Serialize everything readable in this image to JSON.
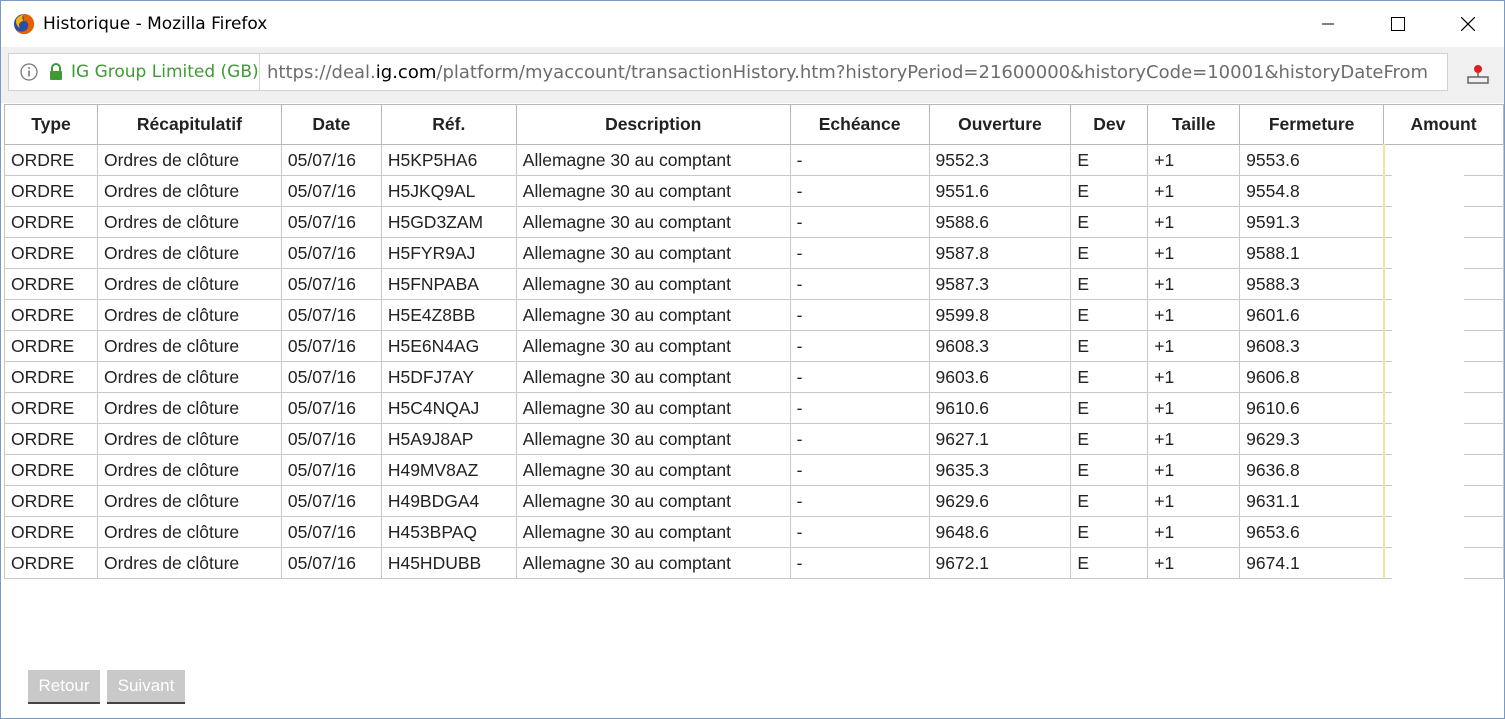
{
  "window": {
    "title": "Historique - Mozilla Firefox"
  },
  "address_bar": {
    "site_identity": "IG Group Limited (GB)",
    "url_prefix": "https://deal.",
    "url_domain": "ig.com",
    "url_path": "/platform/myaccount/transactionHistory.htm?historyPeriod=21600000&historyCode=10001&historyDateFrom"
  },
  "table": {
    "headers": [
      "Type",
      "Récapitulatif",
      "Date",
      "Réf.",
      "Description",
      "Echéance",
      "Ouverture",
      "Dev",
      "Taille",
      "Fermeture",
      "Amount"
    ],
    "rows": [
      [
        "ORDRE",
        "Ordres de clôture",
        "05/07/16",
        "H5KP5HA6",
        "Allemagne 30 au comptant",
        "-",
        "9552.3",
        "E",
        "+1",
        "9553.6",
        ""
      ],
      [
        "ORDRE",
        "Ordres de clôture",
        "05/07/16",
        "H5JKQ9AL",
        "Allemagne 30 au comptant",
        "-",
        "9551.6",
        "E",
        "+1",
        "9554.8",
        ""
      ],
      [
        "ORDRE",
        "Ordres de clôture",
        "05/07/16",
        "H5GD3ZAM",
        "Allemagne 30 au comptant",
        "-",
        "9588.6",
        "E",
        "+1",
        "9591.3",
        ""
      ],
      [
        "ORDRE",
        "Ordres de clôture",
        "05/07/16",
        "H5FYR9AJ",
        "Allemagne 30 au comptant",
        "-",
        "9587.8",
        "E",
        "+1",
        "9588.1",
        ""
      ],
      [
        "ORDRE",
        "Ordres de clôture",
        "05/07/16",
        "H5FNPABA",
        "Allemagne 30 au comptant",
        "-",
        "9587.3",
        "E",
        "+1",
        "9588.3",
        ""
      ],
      [
        "ORDRE",
        "Ordres de clôture",
        "05/07/16",
        "H5E4Z8BB",
        "Allemagne 30 au comptant",
        "-",
        "9599.8",
        "E",
        "+1",
        "9601.6",
        ""
      ],
      [
        "ORDRE",
        "Ordres de clôture",
        "05/07/16",
        "H5E6N4AG",
        "Allemagne 30 au comptant",
        "-",
        "9608.3",
        "E",
        "+1",
        "9608.3",
        ""
      ],
      [
        "ORDRE",
        "Ordres de clôture",
        "05/07/16",
        "H5DFJ7AY",
        "Allemagne 30 au comptant",
        "-",
        "9603.6",
        "E",
        "+1",
        "9606.8",
        ""
      ],
      [
        "ORDRE",
        "Ordres de clôture",
        "05/07/16",
        "H5C4NQAJ",
        "Allemagne 30 au comptant",
        "-",
        "9610.6",
        "E",
        "+1",
        "9610.6",
        ""
      ],
      [
        "ORDRE",
        "Ordres de clôture",
        "05/07/16",
        "H5A9J8AP",
        "Allemagne 30 au comptant",
        "-",
        "9627.1",
        "E",
        "+1",
        "9629.3",
        ""
      ],
      [
        "ORDRE",
        "Ordres de clôture",
        "05/07/16",
        "H49MV8AZ",
        "Allemagne 30 au comptant",
        "-",
        "9635.3",
        "E",
        "+1",
        "9636.8",
        ""
      ],
      [
        "ORDRE",
        "Ordres de clôture",
        "05/07/16",
        "H49BDGA4",
        "Allemagne 30 au comptant",
        "-",
        "9629.6",
        "E",
        "+1",
        "9631.1",
        ""
      ],
      [
        "ORDRE",
        "Ordres de clôture",
        "05/07/16",
        "H453BPAQ",
        "Allemagne 30 au comptant",
        "-",
        "9648.6",
        "E",
        "+1",
        "9653.6",
        ""
      ],
      [
        "ORDRE",
        "Ordres de clôture",
        "05/07/16",
        "H45HDUBB",
        "Allemagne 30 au comptant",
        "-",
        "9672.1",
        "E",
        "+1",
        "9674.1",
        ""
      ]
    ]
  },
  "pagination": {
    "prev_label": "Retour",
    "next_label": "Suivant"
  },
  "colors": {
    "site_identity": "#3e9b34",
    "button_bg": "#c9c9c9",
    "window_border": "#7a9ac6"
  }
}
